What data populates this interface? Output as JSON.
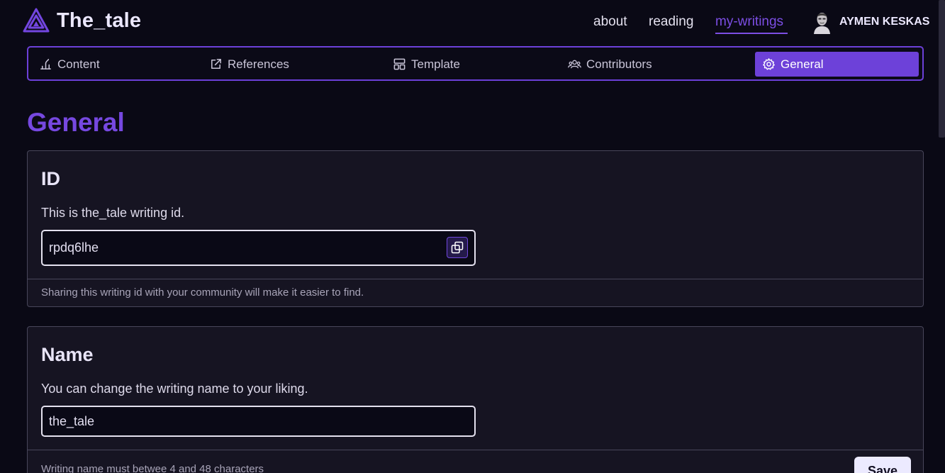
{
  "brand": {
    "name": "The_tale"
  },
  "nav": {
    "links": [
      {
        "label": "about"
      },
      {
        "label": "reading"
      },
      {
        "label": "my-writings"
      }
    ],
    "user_name": "AYMEN KESKAS"
  },
  "tabs": [
    {
      "label": "Content",
      "icon": "content-icon"
    },
    {
      "label": "References",
      "icon": "external-link-icon"
    },
    {
      "label": "Template",
      "icon": "template-icon"
    },
    {
      "label": "Contributors",
      "icon": "users-icon"
    },
    {
      "label": "General",
      "icon": "gear-icon"
    }
  ],
  "page_title": "General",
  "id_card": {
    "title": "ID",
    "description": "This is the_tale writing id.",
    "value": "rpdq6lhe",
    "footer": "Sharing this writing id with your community will make it easier to find."
  },
  "name_card": {
    "title": "Name",
    "description": "You can change the writing name to your liking.",
    "value": "the_tale",
    "footer": "Writing name must betwee 4 and 48 characters",
    "save_label": "Save"
  },
  "colors": {
    "accent": "#6d41d9",
    "background": "#0a0915",
    "card": "#161422"
  }
}
